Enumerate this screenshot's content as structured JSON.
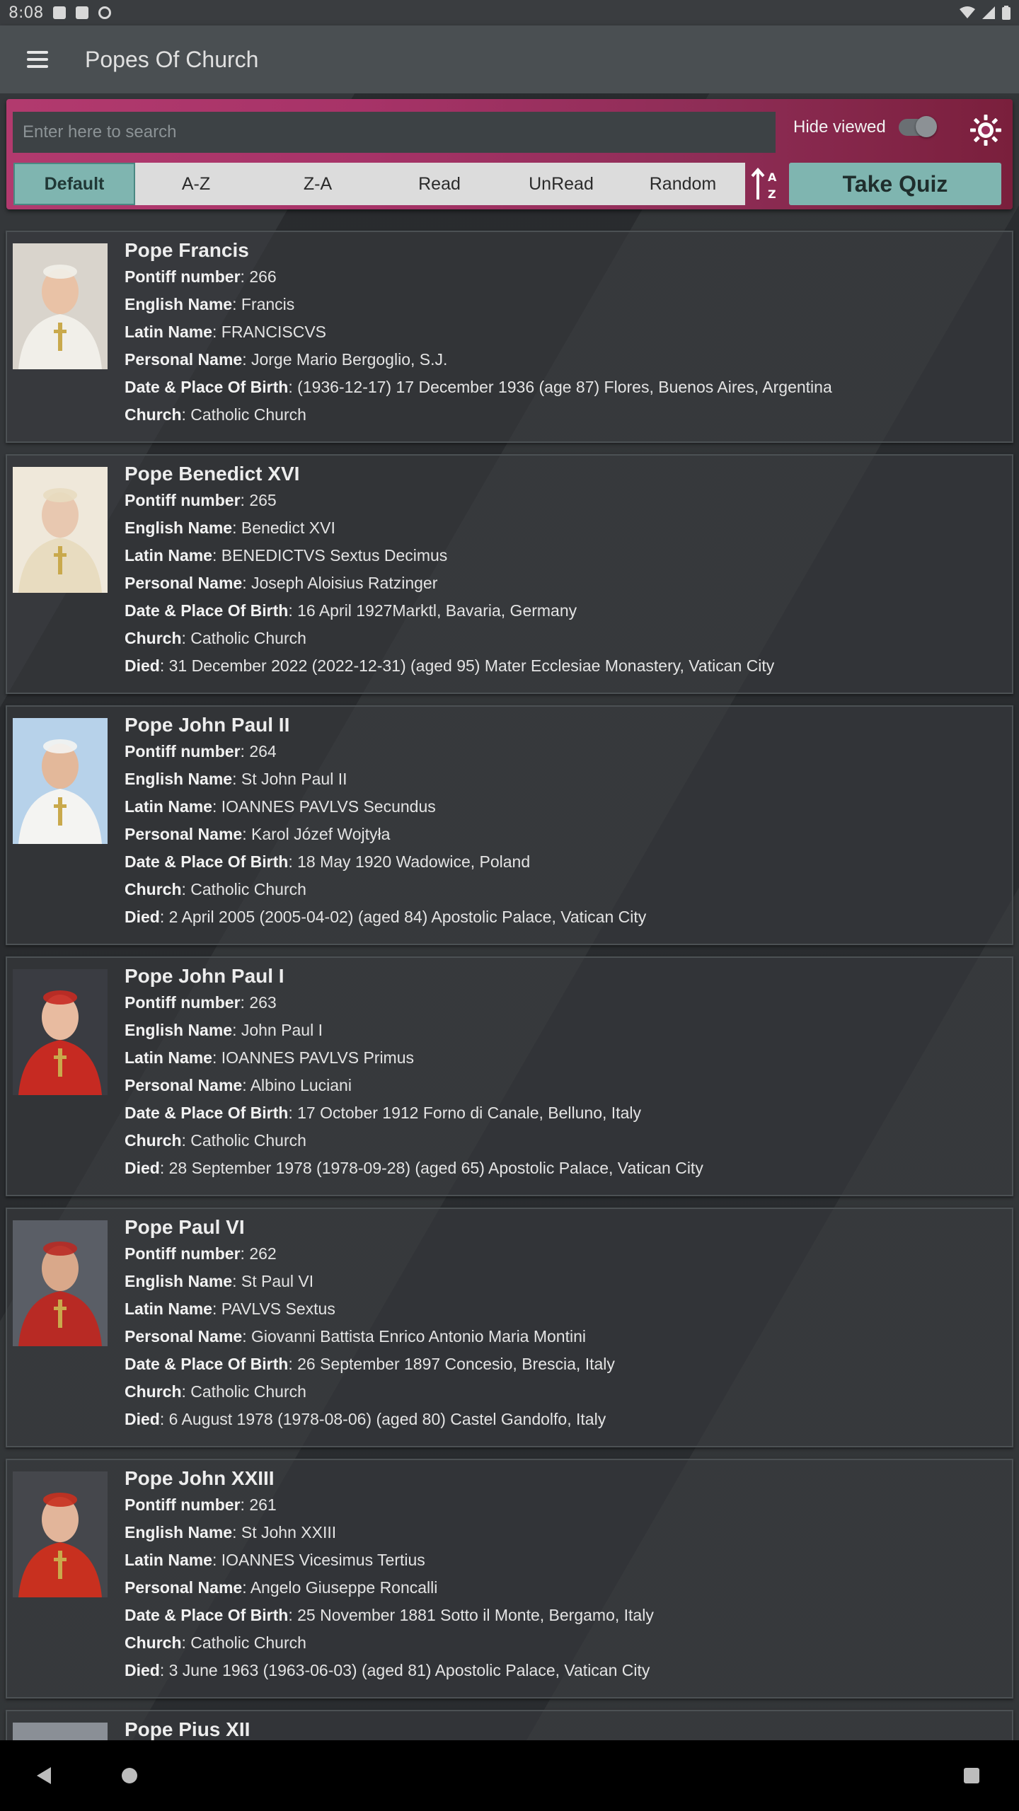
{
  "status_bar": {
    "time": "8:08"
  },
  "app_bar": {
    "title": "Popes Of Church"
  },
  "filter": {
    "search_placeholder": "Enter here to search",
    "hide_viewed_label": "Hide viewed",
    "sort_options": [
      "Default",
      "A-Z",
      "Z-A",
      "Read",
      "UnRead",
      "Random"
    ],
    "active_sort": "Default",
    "quiz_label": "Take Quiz"
  },
  "popes": [
    {
      "name": "Pope Francis",
      "robe": "#f1efe9",
      "skin": "#e9c2a6",
      "bg": "#d9d4cc",
      "fields": [
        {
          "label": "Pontiff number",
          "value": ": 266"
        },
        {
          "label": "English Name",
          "value": ": Francis"
        },
        {
          "label": "Latin Name",
          "value": ": FRANCISCVS"
        },
        {
          "label": "Personal Name",
          "value": ": Jorge Mario Bergoglio, S.J."
        },
        {
          "label": "Date & Place Of Birth",
          "value": ": (1936-12-17) 17 December 1936 (age 87) Flores, Buenos Aires, Argentina"
        },
        {
          "label": "Church",
          "value": ": Catholic Church"
        }
      ]
    },
    {
      "name": "Pope Benedict XVI",
      "robe": "#e8dcc0",
      "skin": "#e8c8b0",
      "bg": "#efe8da",
      "fields": [
        {
          "label": "Pontiff number",
          "value": ": 265"
        },
        {
          "label": "English Name",
          "value": ": Benedict XVI"
        },
        {
          "label": "Latin Name",
          "value": ": BENEDICTVS Sextus Decimus"
        },
        {
          "label": "Personal Name",
          "value": ": Joseph Aloisius Ratzinger"
        },
        {
          "label": "Date & Place Of Birth",
          "value": ": 16 April 1927Marktl, Bavaria, Germany"
        },
        {
          "label": "Church",
          "value": ": Catholic Church"
        },
        {
          "label": "Died",
          "value": ": 31 December 2022 (2022-12-31) (aged 95) Mater Ecclesiae Monastery, Vatican City"
        }
      ]
    },
    {
      "name": "Pope John Paul II",
      "robe": "#f4f4f2",
      "skin": "#e3b89a",
      "bg": "#b7d2ea",
      "fields": [
        {
          "label": "Pontiff number",
          "value": ": 264"
        },
        {
          "label": "English Name",
          "value": ": St John Paul II"
        },
        {
          "label": "Latin Name",
          "value": ": IOANNES PAVLVS Secundus"
        },
        {
          "label": "Personal Name",
          "value": ": Karol Józef Wojtyła"
        },
        {
          "label": "Date & Place Of Birth",
          "value": ": 18 May 1920 Wadowice, Poland"
        },
        {
          "label": "Church",
          "value": ": Catholic Church"
        },
        {
          "label": "Died",
          "value": ": 2 April 2005 (2005-04-02) (aged 84) Apostolic Palace, Vatican City"
        }
      ]
    },
    {
      "name": "Pope John Paul I",
      "robe": "#c62a22",
      "skin": "#e8bba0",
      "bg": "#3a3c42",
      "fields": [
        {
          "label": "Pontiff number",
          "value": ": 263"
        },
        {
          "label": "English Name",
          "value": ": John Paul I"
        },
        {
          "label": "Latin Name",
          "value": ": IOANNES PAVLVS Primus"
        },
        {
          "label": "Personal Name",
          "value": ": Albino Luciani"
        },
        {
          "label": "Date & Place Of Birth",
          "value": ": 17 October 1912 Forno di Canale, Belluno, Italy"
        },
        {
          "label": "Church",
          "value": ": Catholic Church"
        },
        {
          "label": "Died",
          "value": ": 28 September 1978 (1978-09-28) (aged 65) Apostolic Palace, Vatican City"
        }
      ]
    },
    {
      "name": "Pope Paul VI",
      "robe": "#b82a24",
      "skin": "#d9a88a",
      "bg": "#5a5e66",
      "fields": [
        {
          "label": "Pontiff number",
          "value": ": 262"
        },
        {
          "label": "English Name",
          "value": ": St Paul VI"
        },
        {
          "label": "Latin Name",
          "value": ": PAVLVS Sextus"
        },
        {
          "label": "Personal Name",
          "value": ": Giovanni Battista Enrico Antonio Maria Montini"
        },
        {
          "label": "Date & Place Of Birth",
          "value": ": 26 September 1897 Concesio, Brescia, Italy"
        },
        {
          "label": "Church",
          "value": ": Catholic Church"
        },
        {
          "label": "Died",
          "value": ": 6 August 1978 (1978-08-06) (aged 80) Castel Gandolfo, Italy"
        }
      ]
    },
    {
      "name": "Pope John XXIII",
      "robe": "#c8301f",
      "skin": "#e2b59a",
      "bg": "#45474c",
      "fields": [
        {
          "label": "Pontiff number",
          "value": ": 261"
        },
        {
          "label": "English Name",
          "value": ": St John XXIII"
        },
        {
          "label": "Latin Name",
          "value": ": IOANNES Vicesimus Tertius"
        },
        {
          "label": "Personal Name",
          "value": ": Angelo Giuseppe Roncalli"
        },
        {
          "label": "Date & Place Of Birth",
          "value": ": 25 November 1881 Sotto il Monte, Bergamo, Italy"
        },
        {
          "label": "Church",
          "value": ": Catholic Church"
        },
        {
          "label": "Died",
          "value": ": 3 June 1963 (1963-06-03) (aged 81) Apostolic Palace, Vatican City"
        }
      ]
    },
    {
      "name": "Pope Pius XII",
      "robe": "#d8d8d8",
      "skin": "#cfc7bd",
      "bg": "#8a8f96",
      "fields": []
    }
  ]
}
